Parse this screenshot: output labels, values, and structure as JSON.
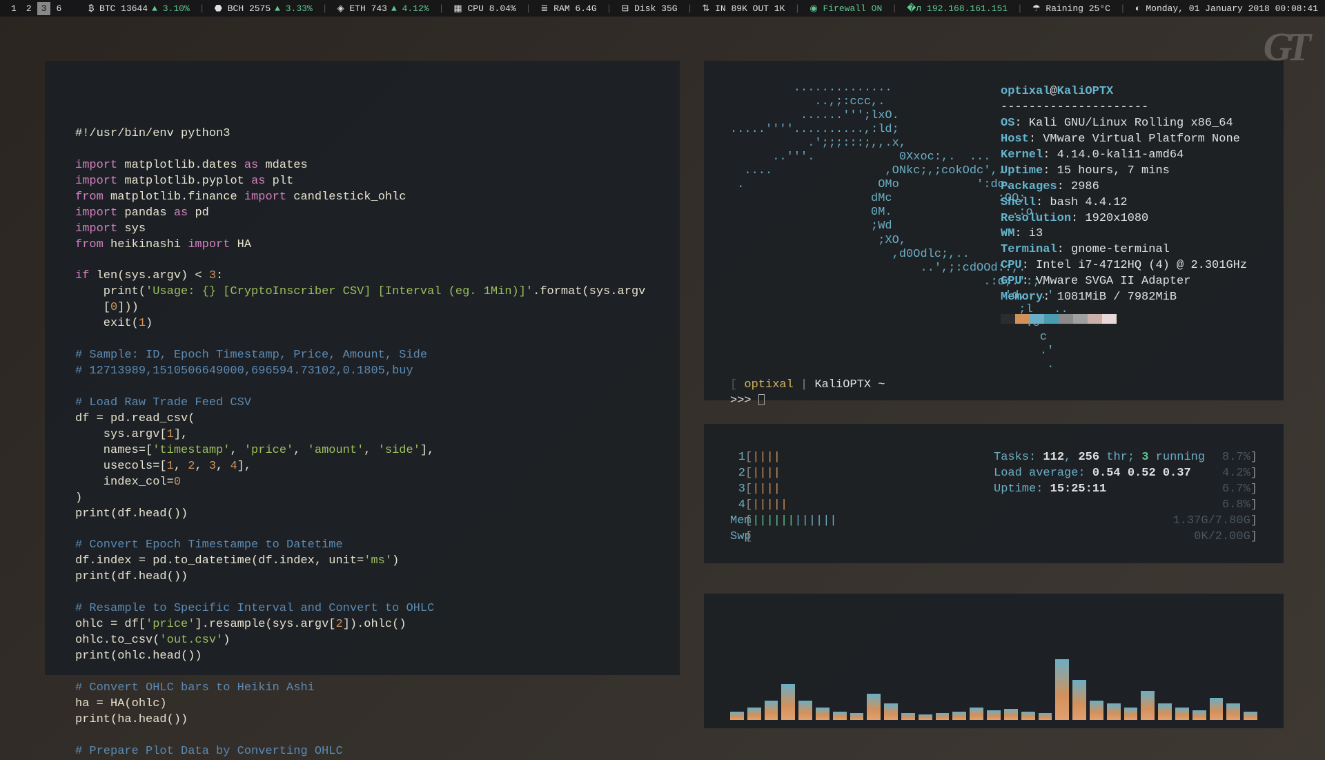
{
  "statusbar": {
    "workspaces": [
      "1",
      "2",
      "3",
      "6"
    ],
    "active_ws": 2,
    "btc": {
      "label": "BTC",
      "price": "13644",
      "change": "3.10%"
    },
    "bch": {
      "label": "BCH",
      "price": "2575",
      "change": "3.33%"
    },
    "eth": {
      "label": "ETH",
      "price": "743",
      "change": "4.12%"
    },
    "cpu": "CPU 8.04%",
    "ram": "RAM 6.4G",
    "disk": "Disk 35G",
    "net": "IN 89K OUT 1K",
    "firewall": "Firewall ON",
    "ip": "192.168.161.151",
    "weather": "Raining 25°C",
    "datetime": "Monday, 01 January 2018 00:08:41"
  },
  "editor": {
    "shebang": "#!/usr/bin/env python3",
    "lines": [
      {
        "t": "",
        "c": ""
      },
      {
        "t": "kw",
        "c": "import"
      },
      {
        "t": "mod",
        "c": " matplotlib.dates "
      },
      {
        "t": "kw",
        "c": "as"
      },
      {
        "t": "mod",
        "c": " mdates\n"
      },
      {
        "t": "kw",
        "c": "import"
      },
      {
        "t": "mod",
        "c": " matplotlib.pyplot "
      },
      {
        "t": "kw",
        "c": "as"
      },
      {
        "t": "mod",
        "c": " plt\n"
      },
      {
        "t": "kw",
        "c": "from"
      },
      {
        "t": "mod",
        "c": " matplotlib.finance "
      },
      {
        "t": "kw",
        "c": "import"
      },
      {
        "t": "mod",
        "c": " candlestick_ohlc\n"
      },
      {
        "t": "kw",
        "c": "import"
      },
      {
        "t": "mod",
        "c": " pandas "
      },
      {
        "t": "kw",
        "c": "as"
      },
      {
        "t": "mod",
        "c": " pd\n"
      },
      {
        "t": "kw",
        "c": "import"
      },
      {
        "t": "mod",
        "c": " sys\n"
      },
      {
        "t": "kw",
        "c": "from"
      },
      {
        "t": "mod",
        "c": " heikinashi "
      },
      {
        "t": "kw",
        "c": "import"
      },
      {
        "t": "mod",
        "c": " HA\n\n"
      },
      {
        "t": "kw",
        "c": "if"
      },
      {
        "t": "mod",
        "c": " len(sys.argv) < "
      },
      {
        "t": "num",
        "c": "3"
      },
      {
        "t": "mod",
        "c": ":\n    print("
      },
      {
        "t": "str",
        "c": "'Usage: {} [CryptoInscriber CSV] [Interval (eg. 1Min)]'"
      },
      {
        "t": "mod",
        "c": ".format(sys.argv\n    ["
      },
      {
        "t": "num",
        "c": "0"
      },
      {
        "t": "mod",
        "c": "]))\n    exit("
      },
      {
        "t": "num",
        "c": "1"
      },
      {
        "t": "mod",
        "c": ")\n\n"
      },
      {
        "t": "cmt",
        "c": "# Sample: ID, Epoch Timestamp, Price, Amount, Side\n# 12713989,1510506649000,696594.73102,0.1805,buy\n\n# Load Raw Trade Feed CSV\n"
      },
      {
        "t": "mod",
        "c": "df = pd.read_csv(\n    sys.argv["
      },
      {
        "t": "num",
        "c": "1"
      },
      {
        "t": "mod",
        "c": "],\n    names=["
      },
      {
        "t": "str",
        "c": "'timestamp'"
      },
      {
        "t": "mod",
        "c": ", "
      },
      {
        "t": "str",
        "c": "'price'"
      },
      {
        "t": "mod",
        "c": ", "
      },
      {
        "t": "str",
        "c": "'amount'"
      },
      {
        "t": "mod",
        "c": ", "
      },
      {
        "t": "str",
        "c": "'side'"
      },
      {
        "t": "mod",
        "c": "],\n    usecols=["
      },
      {
        "t": "num",
        "c": "1"
      },
      {
        "t": "mod",
        "c": ", "
      },
      {
        "t": "num",
        "c": "2"
      },
      {
        "t": "mod",
        "c": ", "
      },
      {
        "t": "num",
        "c": "3"
      },
      {
        "t": "mod",
        "c": ", "
      },
      {
        "t": "num",
        "c": "4"
      },
      {
        "t": "mod",
        "c": "],\n    index_col="
      },
      {
        "t": "num",
        "c": "0"
      },
      {
        "t": "mod",
        "c": "\n)\nprint(df.head())\n\n"
      },
      {
        "t": "cmt",
        "c": "# Convert Epoch Timestampe to Datetime\n"
      },
      {
        "t": "mod",
        "c": "df.index = pd.to_datetime(df.index, unit="
      },
      {
        "t": "str",
        "c": "'ms'"
      },
      {
        "t": "mod",
        "c": ")\nprint(df.head())\n\n"
      },
      {
        "t": "cmt",
        "c": "# Resample to Specific Interval and Convert to OHLC\n"
      },
      {
        "t": "mod",
        "c": "ohlc = df["
      },
      {
        "t": "str",
        "c": "'price'"
      },
      {
        "t": "mod",
        "c": "].resample(sys.argv["
      },
      {
        "t": "num",
        "c": "2"
      },
      {
        "t": "mod",
        "c": "]).ohlc()\nohlc.to_csv("
      },
      {
        "t": "str",
        "c": "'out.csv'"
      },
      {
        "t": "mod",
        "c": ")\nprint(ohlc.head())\n\n"
      },
      {
        "t": "cmt",
        "c": "# Convert OHLC bars to Heikin Ashi\n"
      },
      {
        "t": "mod",
        "c": "ha = HA(ohlc)\nprint(ha.head())\n\n"
      },
      {
        "t": "cmt",
        "c": "# Prepare Plot Data by Converting OHLC"
      }
    ]
  },
  "neofetch": {
    "ascii": "         ..............\n            ..,;:ccc,.\n          ......''';lxO.\n.....''''..........,:ld;\n           .';;;:::;,,.x,\n      ..'''.            0Xxoc:,.  ...\n  ....                ,ONkc;,;cokOdc',.\n .                   OMo           ':do.\n                    dMc               :OO;\n                    0M.                 .:o.\n                    ;Wd\n                     ;XO,\n                       ,d0Odlc;,..\n                           ..',;:cdOOd::,.\n                                    .:d;.':;.\n                                       'd,  .'\n                                         ;l   ..\n                                          .o\n                                            c\n                                            .'\n                                             .",
    "user": "optixal",
    "host": "KaliOPTX",
    "sep": "---------------------",
    "info": [
      {
        "k": "OS",
        "v": "Kali GNU/Linux Rolling x86_64"
      },
      {
        "k": "Host",
        "v": "VMware Virtual Platform None"
      },
      {
        "k": "Kernel",
        "v": "4.14.0-kali1-amd64"
      },
      {
        "k": "Uptime",
        "v": "15 hours, 7 mins"
      },
      {
        "k": "Packages",
        "v": "2986"
      },
      {
        "k": "Shell",
        "v": "bash 4.4.12"
      },
      {
        "k": "Resolution",
        "v": "1920x1080"
      },
      {
        "k": "WM",
        "v": "i3"
      },
      {
        "k": "Terminal",
        "v": "gnome-terminal"
      },
      {
        "k": "CPU",
        "v": "Intel i7-4712HQ (4) @ 2.301GHz"
      },
      {
        "k": "GPU",
        "v": "VMware SVGA II Adapter"
      },
      {
        "k": "Memory",
        "v": "1081MiB / 7982MiB"
      }
    ],
    "palette": [
      "#2c2c2c",
      "#d2915b",
      "#6baec5",
      "#4a9db0",
      "#8a8a8a",
      "#a0a0a0",
      "#ccb0a8",
      "#e8d8d8"
    ],
    "prompt_path": "~",
    "prompt_repl": ">>> "
  },
  "htop": {
    "cpus": [
      {
        "n": "1",
        "bars": "||||",
        "pct": "8.7%"
      },
      {
        "n": "2",
        "bars": "||||",
        "pct": "4.2%"
      },
      {
        "n": "3",
        "bars": "||||",
        "pct": "6.7%"
      },
      {
        "n": "4",
        "bars": "|||||",
        "pct": "6.8%"
      }
    ],
    "mem": {
      "label": "Mem",
      "bars": "||||||||||||",
      "val": "1.37G/7.80G"
    },
    "swp": {
      "label": "Swp",
      "bars": "",
      "val": "0K/2.00G"
    },
    "tasks_label": "Tasks: ",
    "tasks_n": "112",
    "tasks_sep": ", ",
    "thr_n": "256",
    "thr_lbl": " thr; ",
    "run_n": "3",
    "run_lbl": " running",
    "load_label": "Load average: ",
    "load": "0.54 0.52 0.37",
    "uptime_label": "Uptime: ",
    "uptime": "15:25:11"
  },
  "viz": {
    "bars": [
      12,
      18,
      28,
      52,
      28,
      18,
      12,
      10,
      38,
      24,
      10,
      8,
      10,
      12,
      18,
      14,
      16,
      12,
      10,
      88,
      58,
      28,
      24,
      18,
      42,
      24,
      18,
      14,
      32,
      24,
      12
    ]
  }
}
